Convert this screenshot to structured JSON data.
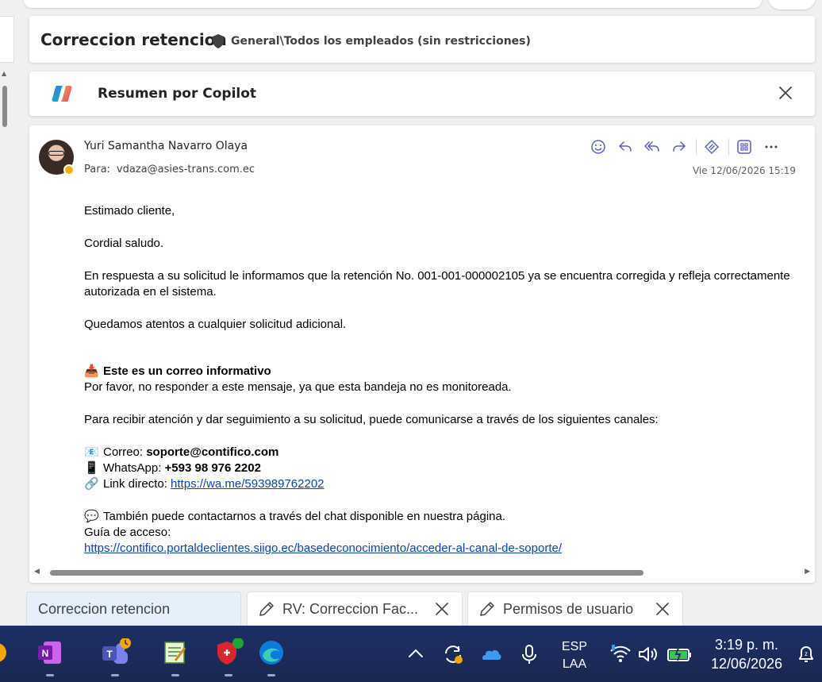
{
  "email": {
    "subject": "Correccion retencion",
    "sensitivity": "General\\Todos los empleados (sin restricciones)",
    "copilot_title": "Resumen por Copilot",
    "sender": "Yuri Samantha Navarro Olaya",
    "to_label": "Para:",
    "to": "vdaza@asies-trans.com.ec",
    "date": "Vie 12/06/2026 15:19",
    "body": {
      "greeting": "Estimado cliente,",
      "salute": "Cordial saludo.",
      "para1": "En respuesta a su solicitud le informamos que la retención No. 001-001-000002105 ya se encuentra corregida y refleja correctamente autorizada en el sistema.",
      "para2": "Quedamos atentos a cualquier solicitud adicional.",
      "info_title": "Este es un correo informativo",
      "info_text": "Por favor, no responder a este mensaje, ya que esta bandeja no es monitoreada.",
      "channels_intro": "Para recibir atención y dar seguimiento a su solicitud, puede comunicarse a través de los siguientes canales:",
      "mail_label": "Correo:",
      "mail_value": "soporte@contifico.com",
      "whatsapp_label": "WhatsApp:",
      "whatsapp_value": "+593 98 976 2202",
      "link_label": "Link directo:",
      "link_value": "https://wa.me/593989762202",
      "chat_text": "También puede contactarnos a través del chat disponible en nuestra página.",
      "guide_label": "Guía de acceso:",
      "guide_link": "https://contifico.portaldeclientes.siigo.ec/basedeconocimiento/acceder-al-canal-de-soporte/"
    }
  },
  "tabs": [
    {
      "label": "Correccion retencion"
    },
    {
      "label": "RV: Correccion Fac..."
    },
    {
      "label": "Permisos de usuario"
    }
  ],
  "taskbar": {
    "lang_top": "ESP",
    "lang_bottom": "LAA",
    "time": "3:19 p. m.",
    "date": "12/06/2026"
  },
  "colors": {
    "accent": "#5b5fc7",
    "link": "#0b3fc4",
    "taskbar": "#1d2f66"
  }
}
